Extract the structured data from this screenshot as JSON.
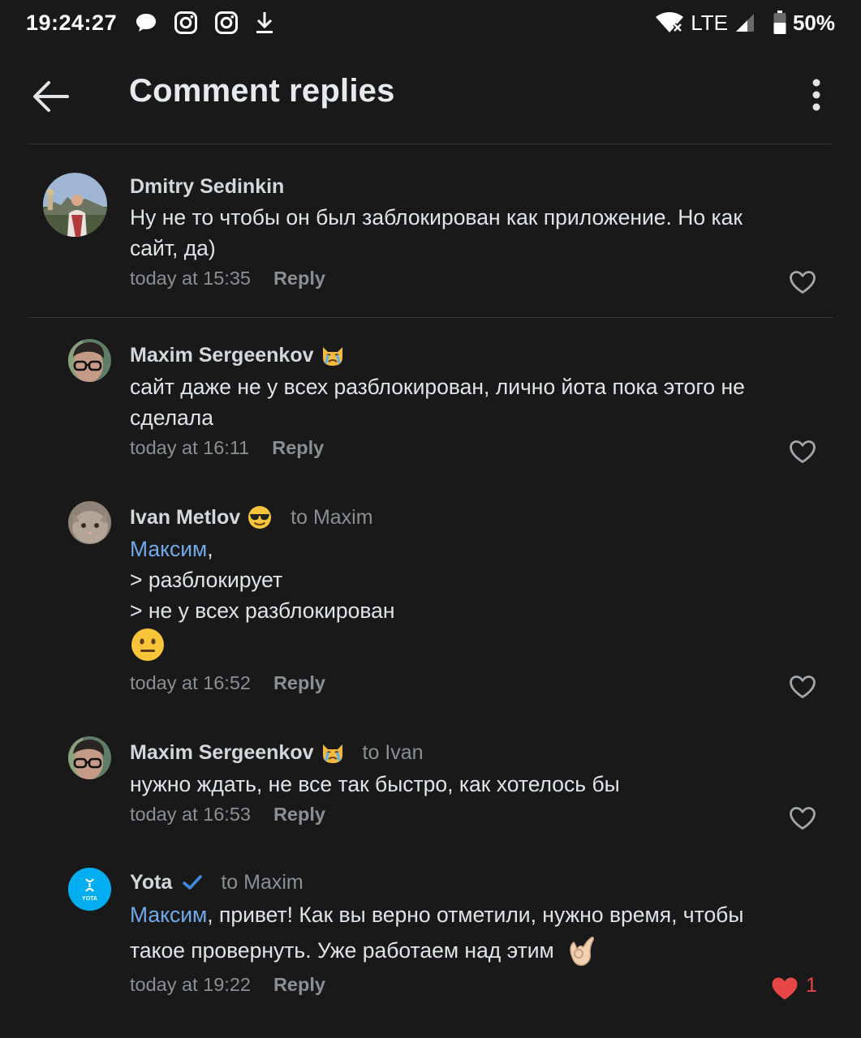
{
  "status_bar": {
    "time": "19:24:27",
    "network": "LTE",
    "battery": "50%"
  },
  "header": {
    "title": "Comment replies"
  },
  "comments": [
    {
      "author": "Dmitry Sedinkin",
      "to": "",
      "mention": "",
      "text_lines": [
        "Ну не то чтобы он был заблокирован как приложение. Но как",
        "сайт, да)"
      ],
      "time": "today at 15:35",
      "reply": "Reply",
      "likes": ""
    },
    {
      "author": "Maxim Sergeenkov",
      "author_emoji": "crying-cat-emoji",
      "to": "",
      "mention": "",
      "text_lines": [
        "сайт даже не у всех разблокирован, лично йота пока этого не",
        "сделала"
      ],
      "time": "today at 16:11",
      "reply": "Reply",
      "likes": ""
    },
    {
      "author": "Ivan Metlov",
      "author_emoji": "sunglasses-emoji",
      "to": "to Maxim",
      "mention": "Максим",
      "mention_suffix": ",",
      "text_lines": [
        "> разблокирует",
        "> не у всех разблокирован"
      ],
      "trailing_emoji": "neutral-face-emoji",
      "time": "today at 16:52",
      "reply": "Reply",
      "likes": ""
    },
    {
      "author": "Maxim Sergeenkov",
      "author_emoji": "crying-cat-emoji",
      "to": "to Ivan",
      "mention": "",
      "text_lines": [
        "нужно ждать, не все так быстро, как хотелось бы"
      ],
      "time": "today at 16:53",
      "reply": "Reply",
      "likes": ""
    },
    {
      "author": "Yota",
      "verified": true,
      "to": "to Maxim",
      "mention": "Максим",
      "mention_suffix": ", привет! Как вы верно отметили, нужно время, чтобы",
      "text_lines": [
        "такое провернуть. Уже работаем над этим"
      ],
      "trailing_emoji": "ok-hand-emoji",
      "time": "today at 19:22",
      "reply": "Reply",
      "likes": "1",
      "liked": true,
      "avatar_text": "YOTA"
    }
  ],
  "colors": {
    "background": "#19191a",
    "mention": "#71aaeb",
    "like_active": "#e64646",
    "verified": "#3f8ae0",
    "yota_brand": "#00aeef"
  }
}
